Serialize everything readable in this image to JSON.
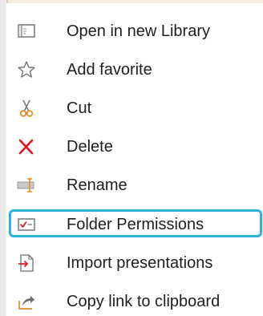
{
  "context_menu": {
    "items": [
      {
        "label": "Open in new Library",
        "icon": "open-library-icon"
      },
      {
        "label": "Add favorite",
        "icon": "star-icon"
      },
      {
        "label": "Cut",
        "icon": "scissors-icon"
      },
      {
        "label": "Delete",
        "icon": "delete-x-icon"
      },
      {
        "label": "Rename",
        "icon": "rename-icon"
      },
      {
        "label": "Folder Permissions",
        "icon": "folder-permissions-icon",
        "highlighted": true
      },
      {
        "label": "Import presentations",
        "icon": "import-icon"
      },
      {
        "label": "Copy link to clipboard",
        "icon": "share-link-icon"
      }
    ]
  },
  "colors": {
    "highlight_border": "#2bb4dd",
    "icon_orange": "#e38a2c",
    "delete_red": "#e0141c",
    "text": "#1e1e1e"
  }
}
